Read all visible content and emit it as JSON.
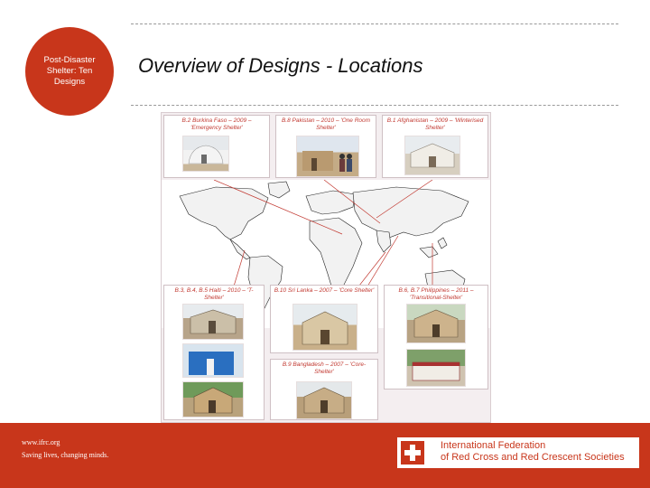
{
  "header": {
    "brand_circle_text": "Post-Disaster Shelter: Ten Designs",
    "title": "Overview of Designs - Locations"
  },
  "figure": {
    "captions": [
      "B.2 Burkina Faso – 2009 – 'Emergency Shelter'",
      "B.8 Pakistan – 2010 – 'One Room Shelter'",
      "B.1 Afghanistan – 2009 – 'Winterised Shelter'",
      "B.3, B.4, B.5 Haiti – 2010 – 'T-Shelter'",
      "B.10 Sri Lanka – 2007 – 'Core Shelter'",
      "B.6, B.7 Philippines – 2011 – 'Transitional-Shelter'",
      "B.9 Bangladesh – 2007 – 'Core-Shelter'"
    ]
  },
  "footer": {
    "url": "www.ifrc.org",
    "slogan": "Saving lives, changing minds.",
    "org_line1": "International Federation",
    "org_line2": "of Red Cross and Red Crescent Societies"
  },
  "colors": {
    "brand_red": "#c8361b",
    "caption_red": "#c23a32"
  }
}
